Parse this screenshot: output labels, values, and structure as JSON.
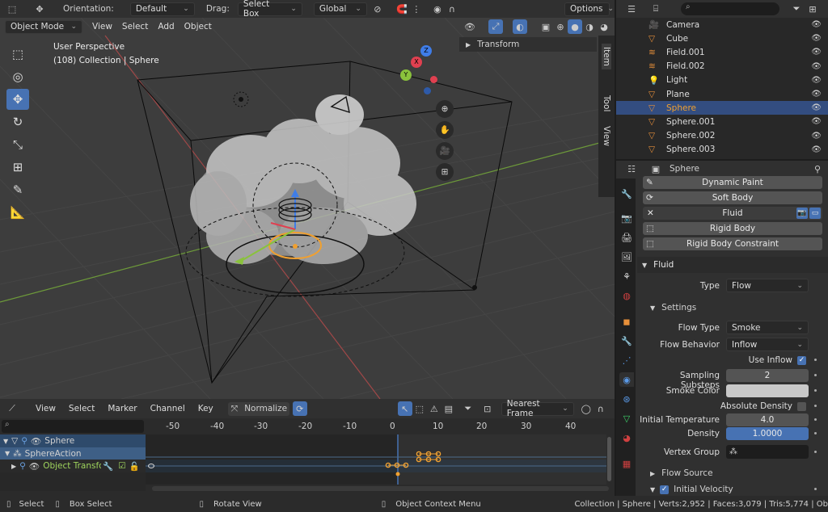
{
  "top_header": {
    "orientation_label": "Orientation:",
    "orientation_value": "Default",
    "drag_label": "Drag:",
    "drag_value": "Select Box",
    "transform_space": "Global",
    "options": "Options"
  },
  "viewport_header": {
    "mode": "Object Mode",
    "menus": [
      "View",
      "Select",
      "Add",
      "Object"
    ]
  },
  "viewport": {
    "perspective": "User Perspective",
    "collection_info": "(108) Collection | Sphere",
    "gizmo": {
      "z": "Z",
      "x": "X",
      "y": "Y"
    }
  },
  "npanel": {
    "transform": "Transform",
    "tabs": [
      "Item",
      "Tool",
      "View"
    ]
  },
  "outliner": {
    "items": [
      {
        "name": "Camera",
        "icon_color": "#e8903a"
      },
      {
        "name": "Cube",
        "icon_color": "#e8903a"
      },
      {
        "name": "Field.001",
        "icon_color": "#e8903a"
      },
      {
        "name": "Field.002",
        "icon_color": "#e8903a"
      },
      {
        "name": "Light",
        "icon_color": "#e8903a"
      },
      {
        "name": "Plane",
        "icon_color": "#e8903a"
      },
      {
        "name": "Sphere",
        "icon_color": "#e8903a",
        "selected": true
      },
      {
        "name": "Sphere.001",
        "icon_color": "#e8903a"
      },
      {
        "name": "Sphere.002",
        "icon_color": "#e8903a"
      },
      {
        "name": "Sphere.003",
        "icon_color": "#e8903a"
      }
    ]
  },
  "properties": {
    "object": "Sphere",
    "buttons": [
      "Dynamic Paint",
      "Soft Body",
      "Fluid",
      "Rigid Body",
      "Rigid Body Constraint"
    ],
    "fluid_header": "Fluid",
    "type_label": "Type",
    "type_value": "Flow",
    "settings_header": "Settings",
    "flow_type_label": "Flow Type",
    "flow_type_value": "Smoke",
    "flow_behavior_label": "Flow Behavior",
    "flow_behavior_value": "Inflow",
    "use_inflow": "Use Inflow",
    "sampling_label": "Sampling Substeps",
    "sampling_value": "2",
    "smoke_color_label": "Smoke Color",
    "absolute_density": "Absolute Density",
    "init_temp_label": "Initial Temperature",
    "init_temp_value": "4.0",
    "density_label": "Density",
    "density_value": "1.0000",
    "vertex_group_label": "Vertex Group",
    "flow_source": "Flow Source",
    "initial_velocity": "Initial Velocity"
  },
  "timeline": {
    "menus": [
      "View",
      "Select",
      "Marker",
      "Channel",
      "Key"
    ],
    "normalize": "Normalize",
    "interp": "Nearest Frame",
    "ticks": [
      "-50",
      "-40",
      "-30",
      "-20",
      "-10",
      "0",
      "10",
      "20",
      "30",
      "40"
    ],
    "channels": [
      {
        "name": "Sphere"
      },
      {
        "name": "SphereAction"
      },
      {
        "name": "Object Transforms"
      }
    ]
  },
  "statusbar": {
    "select": "Select",
    "box_select": "Box Select",
    "rotate": "Rotate View",
    "context": "Object Context Menu",
    "stats": "Collection | Sphere | Verts:2,952 | Faces:3,079 | Tris:5,774 | Ob"
  }
}
